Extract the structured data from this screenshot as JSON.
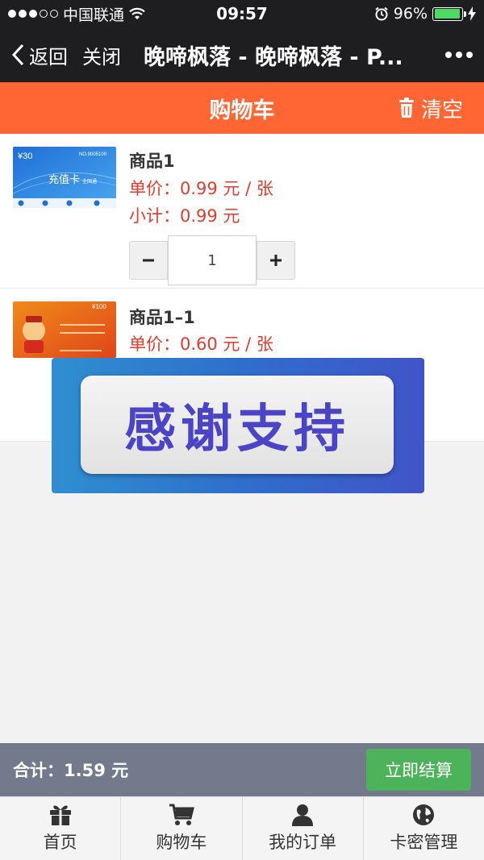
{
  "status_bar": {
    "carrier": "中国联通",
    "time": "09:57",
    "battery": "96%"
  },
  "nav": {
    "back_label": "返回",
    "close_label": "关闭",
    "title": "晚啼枫落 - 晚啼枫落 - P..."
  },
  "header": {
    "title": "购物车",
    "clear_label": "清空"
  },
  "items": [
    {
      "name": "商品1",
      "price": "单价：0.99 元 / 张",
      "subtotal": "小计：0.99 元",
      "quantity": "1",
      "card_value": "¥30",
      "card_no": "NO.9005100",
      "card_title": "充值卡",
      "card_sub": "全国通"
    },
    {
      "name": "商品1–1",
      "price": "单价：0.60 元 / 张",
      "card_value": "¥100"
    }
  ],
  "banner": {
    "text": "感谢支持"
  },
  "summary": {
    "total": "合计：1.59 元",
    "checkout_label": "立即结算"
  },
  "tabs": [
    {
      "label": "首页",
      "icon": "gift-icon"
    },
    {
      "label": "购物车",
      "icon": "cart-icon"
    },
    {
      "label": "我的订单",
      "icon": "user-icon"
    },
    {
      "label": "卡密管理",
      "icon": "globe-icon"
    }
  ],
  "colors": {
    "header": "#ff6634",
    "price": "#e53a2e",
    "checkout": "#4cb35a",
    "summary": "#737a8c"
  }
}
